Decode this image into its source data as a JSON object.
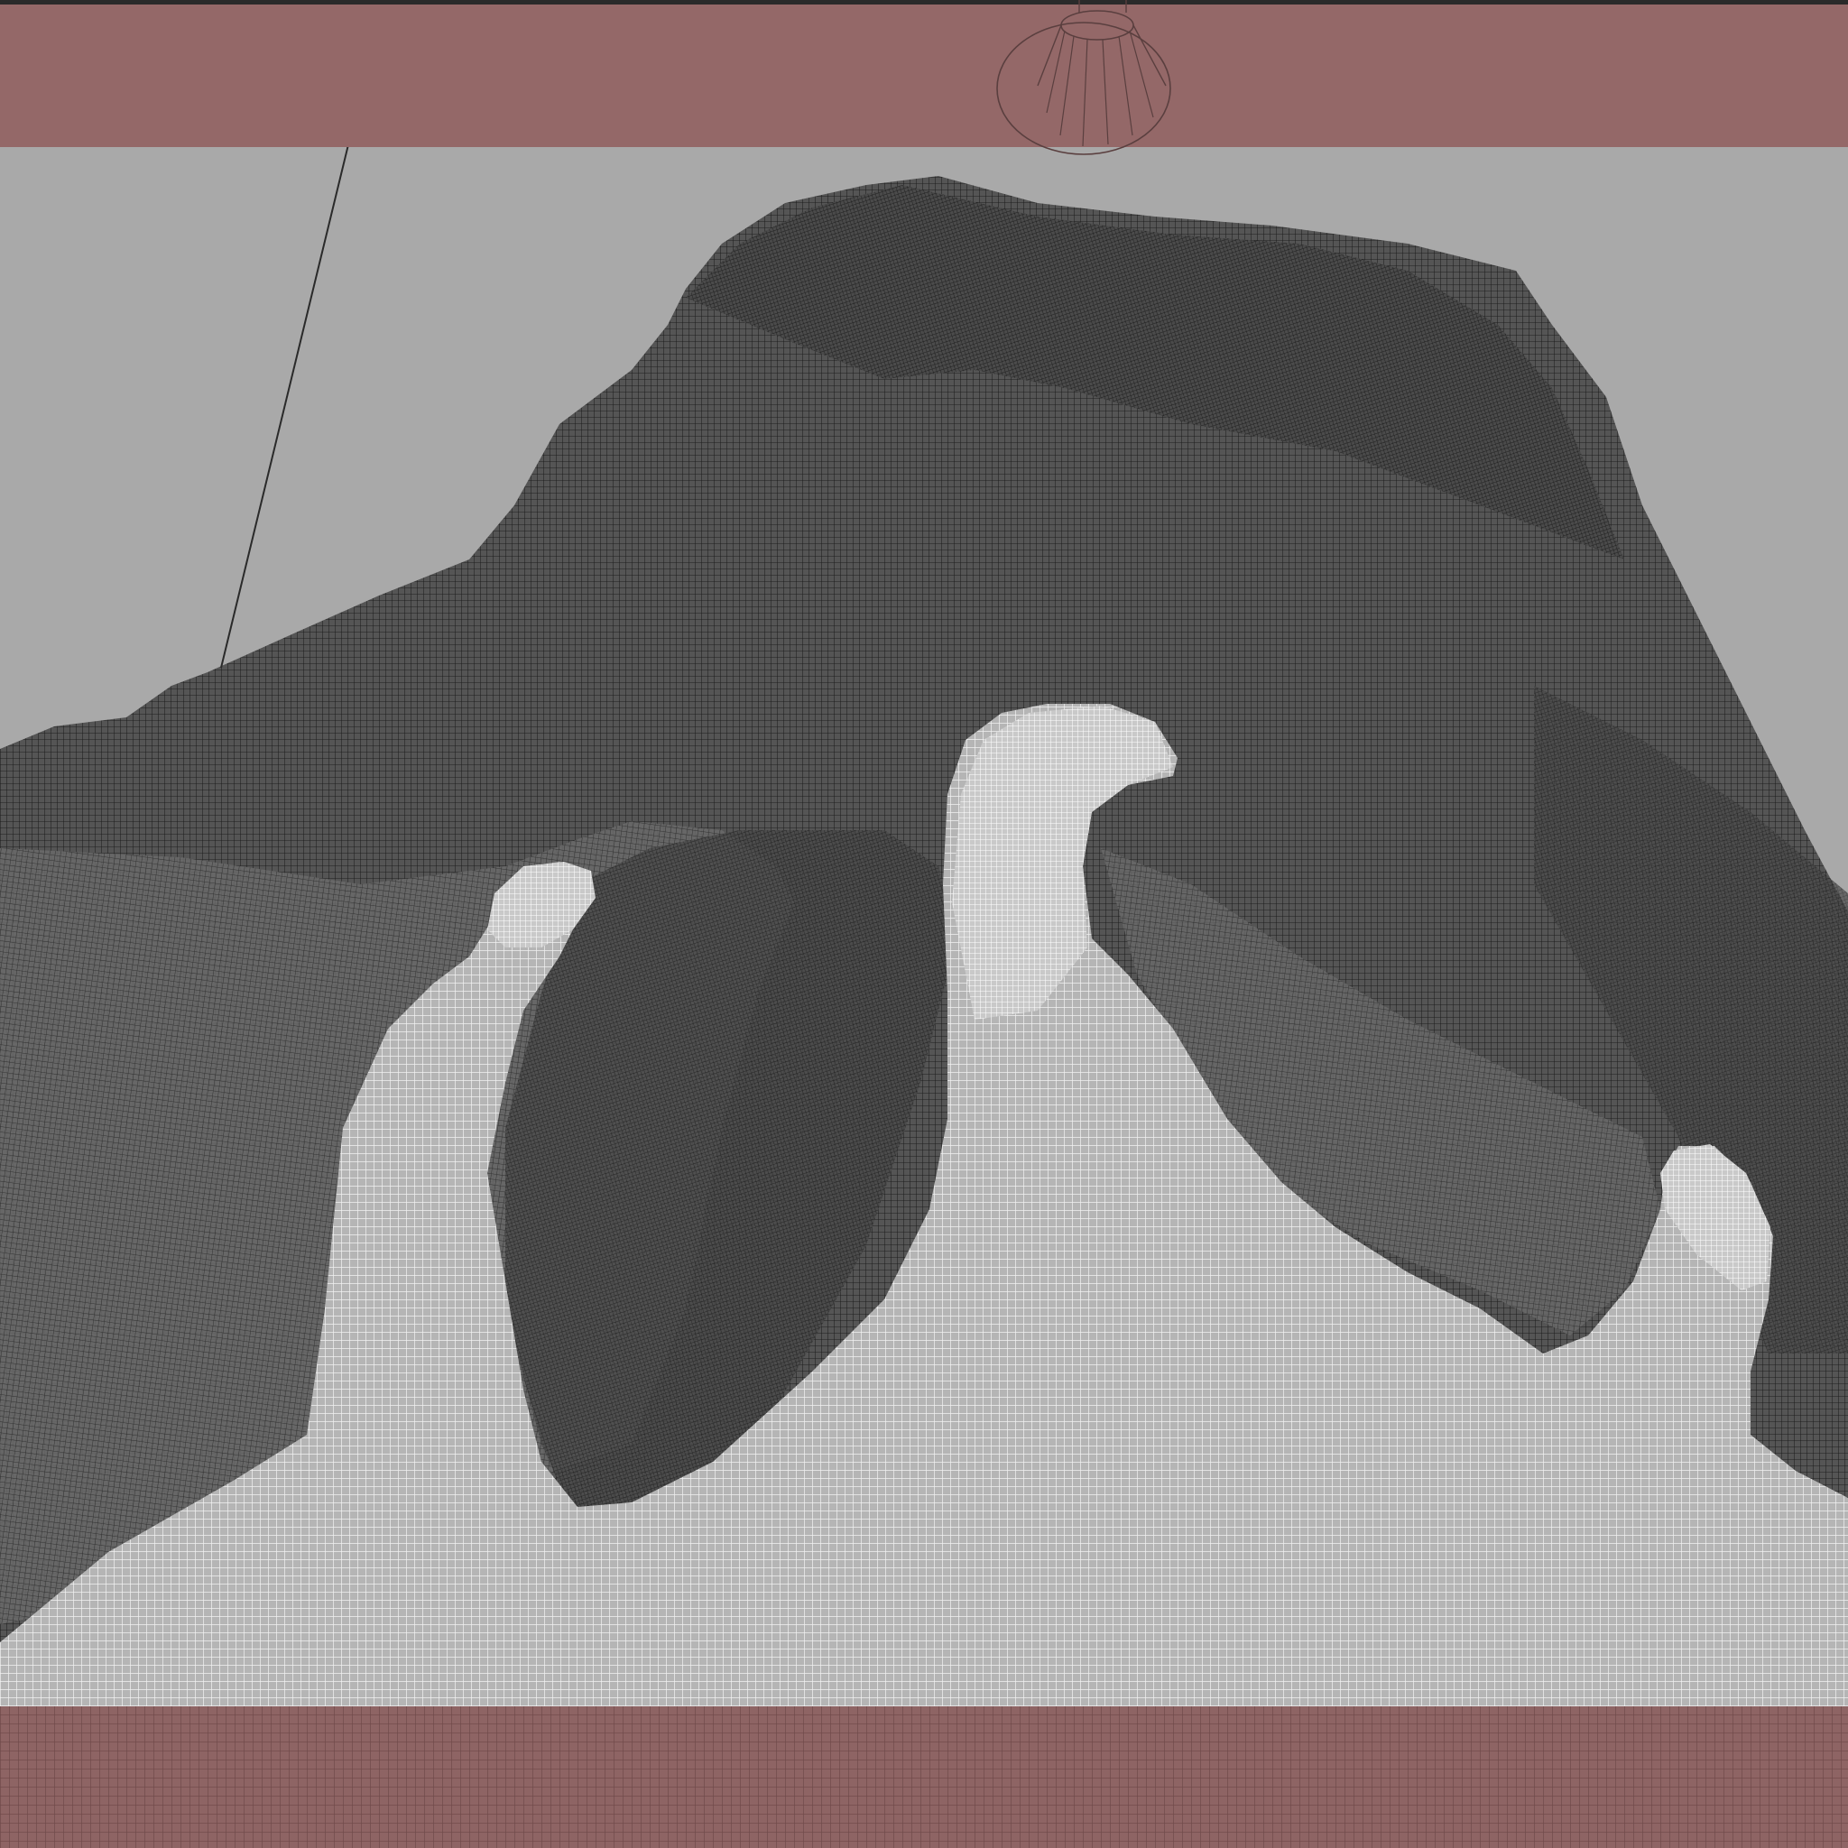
{
  "viewport": {
    "background_color": "#a9a9a9",
    "camera_icon": "camera-gizmo-icon",
    "overlay_color": "#946868"
  },
  "scene": {
    "background_mesh_color": "#4d4d4d",
    "background_wire_color": "#222222",
    "foreground_mesh_color": "#bdbdbd",
    "foreground_wire_color": "#ffffff",
    "shading": "wireframe"
  }
}
